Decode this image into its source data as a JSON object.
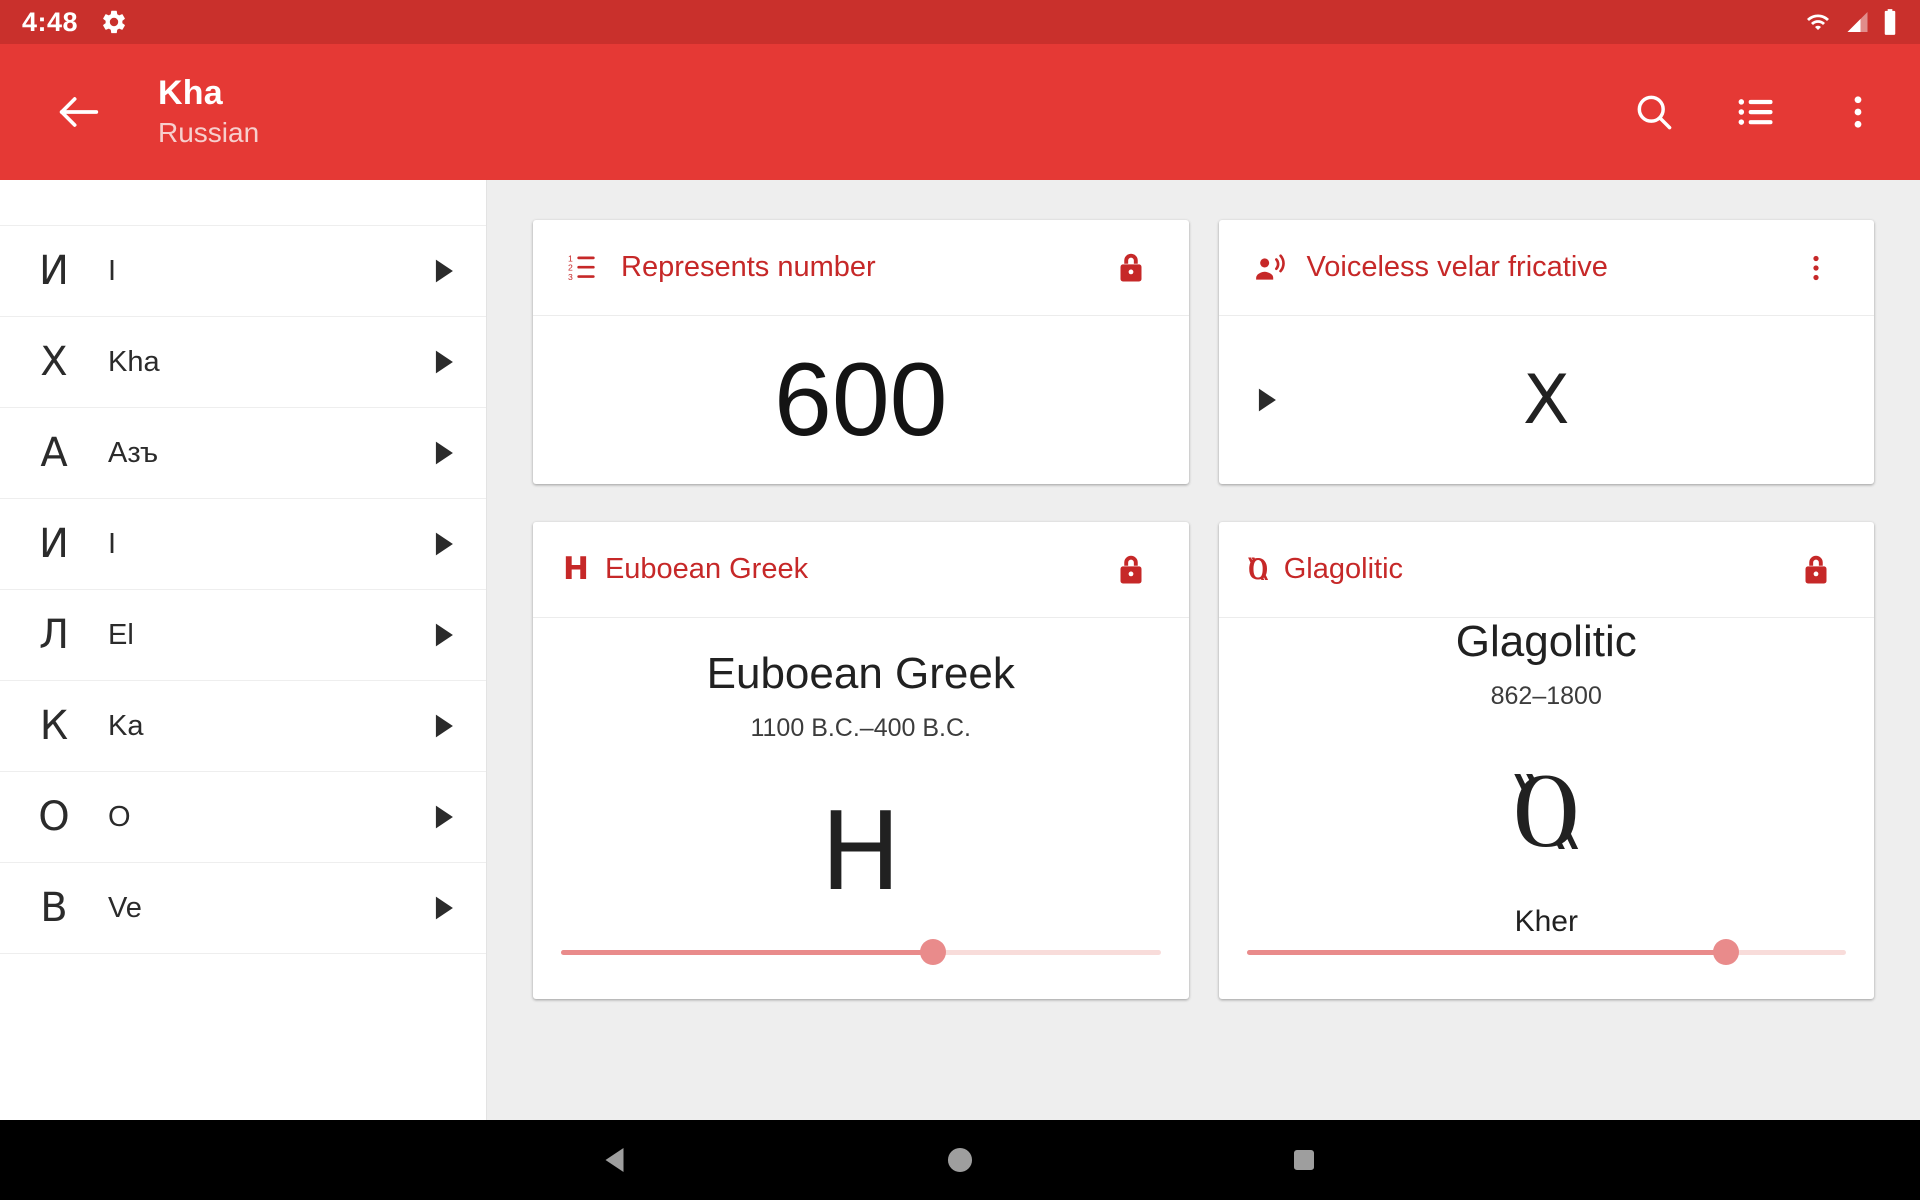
{
  "status_bar": {
    "clock": "4:48",
    "settings_icon": "gear-icon",
    "wifi_icon": "wifi-icon",
    "signal_icon": "cell-signal-icon",
    "battery_icon": "battery-icon"
  },
  "app_bar": {
    "back_icon": "arrow-back-icon",
    "title": "Kha",
    "subtitle": "Russian",
    "actions": [
      {
        "name": "search-icon",
        "label": "Search"
      },
      {
        "name": "list-icon",
        "label": "List"
      },
      {
        "name": "overflow-menu-icon",
        "label": "More options"
      }
    ]
  },
  "sidebar": {
    "items": [
      {
        "glyph": "И",
        "label": "I"
      },
      {
        "glyph": "Х",
        "label": "Kha"
      },
      {
        "glyph": "А",
        "label": "Азъ"
      },
      {
        "glyph": "И",
        "label": "I"
      },
      {
        "glyph": "Л",
        "label": "El"
      },
      {
        "glyph": "К",
        "label": "Ka"
      },
      {
        "glyph": "О",
        "label": "O"
      },
      {
        "glyph": "В",
        "label": "Ve"
      }
    ],
    "row_arrow_icon": "play-arrow-icon"
  },
  "cards": {
    "represents_number": {
      "header_icon": "numbered-list-icon",
      "title": "Represents number",
      "action_icon": "lock-icon",
      "value": "600"
    },
    "voiceless_velar_fricative": {
      "header_icon": "record-voice-over-icon",
      "title": "Voiceless velar fricative",
      "action_icon": "overflow-menu-icon",
      "play_icon": "play-arrow-icon",
      "letter": "Х"
    },
    "euboean_greek": {
      "header_glyph": "H",
      "title": "Euboean Greek",
      "action_icon": "lock-icon",
      "script_name": "Euboean Greek",
      "date_range": "1100 B.C.–400 B.C.",
      "glyph": "H",
      "slider_value": 62
    },
    "glagolitic": {
      "header_glyph": "Ⱒ",
      "title": "Glagolitic",
      "action_icon": "lock-icon",
      "script_name": "Glagolitic",
      "date_range": "862–1800",
      "glyph": "Ⱒ",
      "glyph_label": "Kher",
      "slider_value": 80
    }
  },
  "nav_bar": {
    "back_icon": "nav-back-icon",
    "home_icon": "nav-home-icon",
    "recents_icon": "nav-recents-icon"
  },
  "colors": {
    "status_bar": "#c9302c",
    "app_bar": "#e53935",
    "accent_red": "#c62828",
    "slider_track": "#f8dcda",
    "slider_fill": "#e98b8b",
    "page_bg": "#eeeeee"
  }
}
